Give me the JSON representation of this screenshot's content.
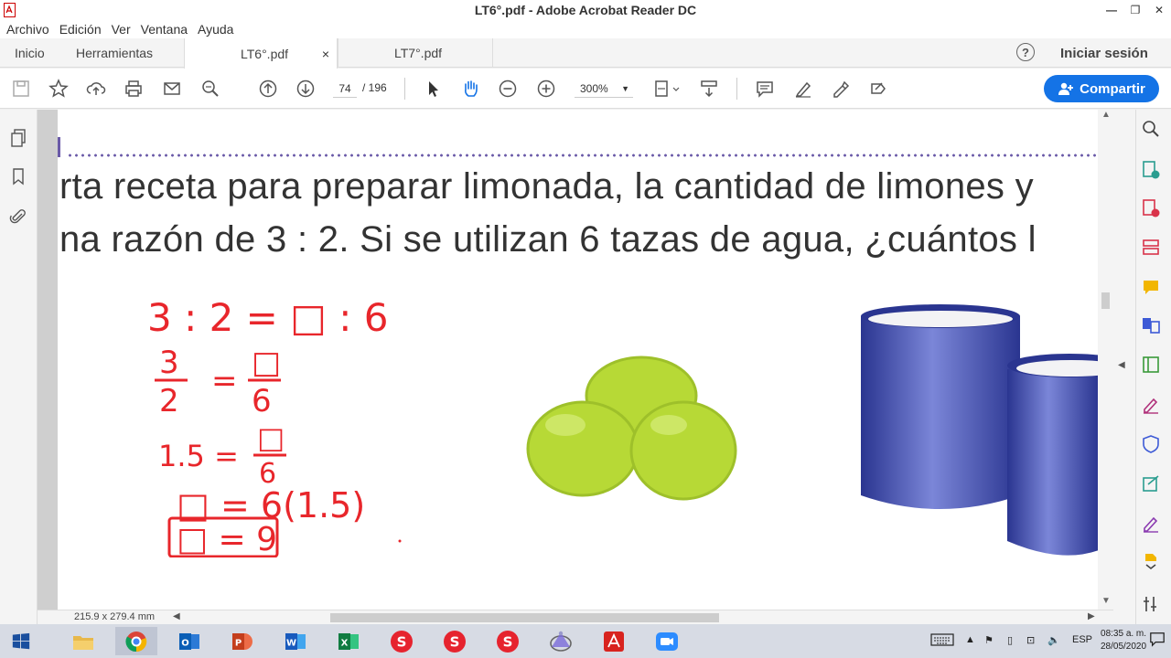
{
  "window": {
    "title": "LT6°.pdf - Adobe Acrobat Reader DC"
  },
  "menu": [
    "Archivo",
    "Edición",
    "Ver",
    "Ventana",
    "Ayuda"
  ],
  "tabs": {
    "home": "Inicio",
    "tools": "Herramientas",
    "doc1": "LT6°.pdf",
    "doc2": "LT7°.pdf",
    "close": "×"
  },
  "header": {
    "help": "?",
    "signin": "Iniciar sesión"
  },
  "toolbar": {
    "page_current": "74",
    "page_total": "/ 196",
    "zoom": "300%",
    "share_label": "Compartir"
  },
  "document": {
    "line1": "rta receta para preparar limonada, la cantidad de limones y",
    "line2": "na razón de 3 : 2. Si se utilizan 6 tazas de agua, ¿cuántos l",
    "handwriting": {
      "line1": "3 : 2 = □ : 6",
      "frac1_num": "3",
      "frac1_den": "2",
      "frac1_rhs_num": "□",
      "frac1_rhs_den": "6",
      "line3_lhs": "1.5 =",
      "line3_num": "□",
      "line3_den": "6",
      "line4": "□ = 6(1.5)",
      "answer": "□ = 9"
    }
  },
  "status": {
    "page_size": "215.9 x 279.4 mm"
  },
  "taskbar": {
    "lang": "ESP",
    "time": "08:35 a. m.",
    "date": "28/05/2020"
  },
  "colors": {
    "accent": "#1473e6",
    "ink": "#e8262b",
    "lemon": "#b7d936",
    "cup": "#3a46a8"
  }
}
